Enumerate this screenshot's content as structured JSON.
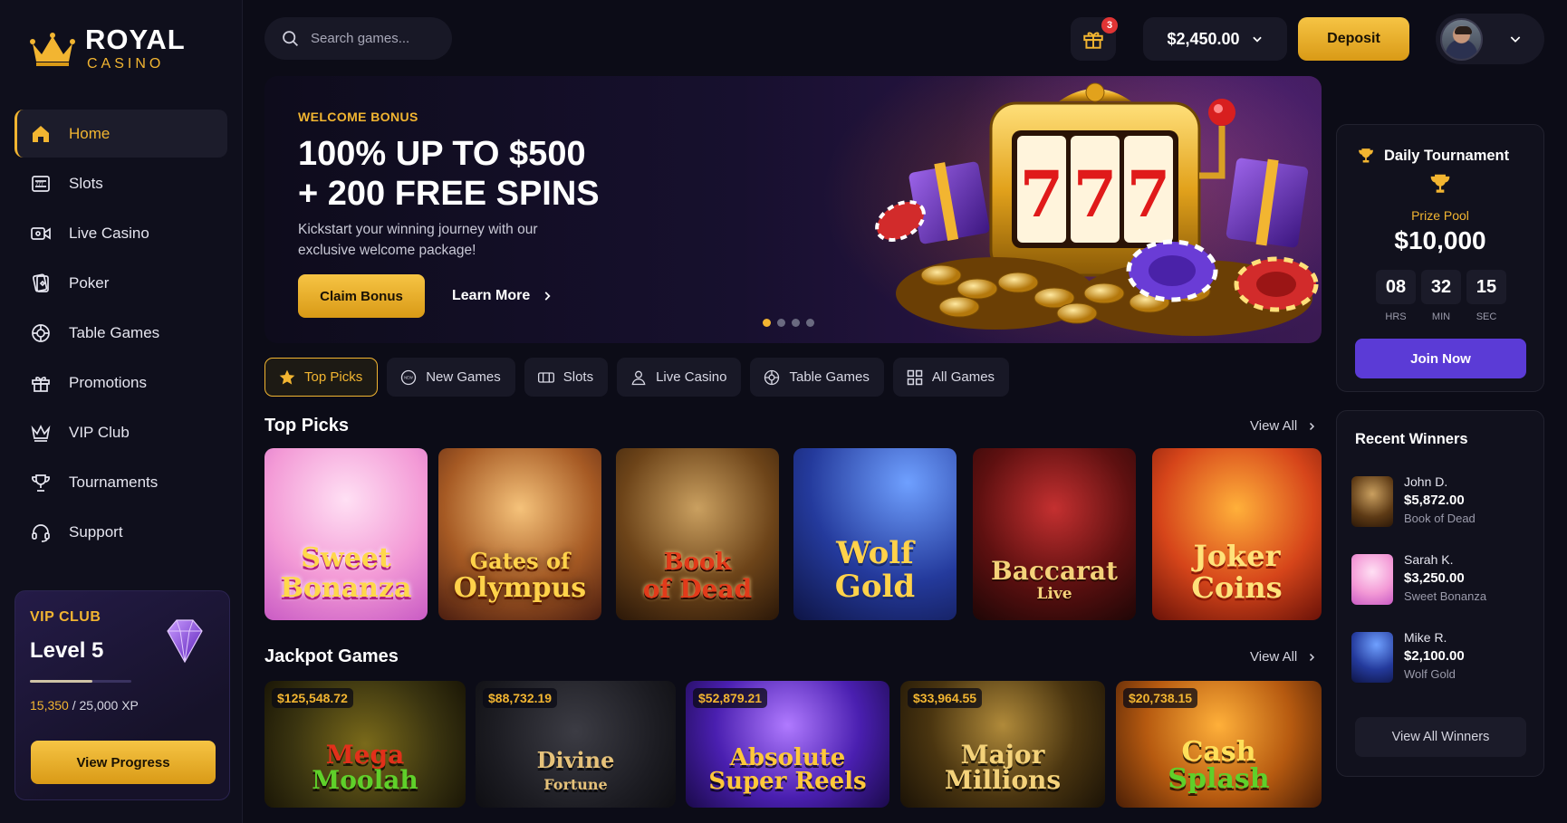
{
  "brand": {
    "name": "ROYAL",
    "sub": "CASINO"
  },
  "nav": [
    {
      "label": "Home",
      "icon": "home-icon",
      "active": true
    },
    {
      "label": "Slots",
      "icon": "slot-machine-icon"
    },
    {
      "label": "Live Casino",
      "icon": "video-camera-icon"
    },
    {
      "label": "Poker",
      "icon": "playing-cards-icon"
    },
    {
      "label": "Table Games",
      "icon": "roulette-icon"
    },
    {
      "label": "Promotions",
      "icon": "gift-icon"
    },
    {
      "label": "VIP Club",
      "icon": "crown-icon"
    },
    {
      "label": "Tournaments",
      "icon": "trophy-icon"
    },
    {
      "label": "Support",
      "icon": "headset-icon"
    }
  ],
  "vip": {
    "title": "VIP CLUB",
    "level": "Level 5",
    "xp_current": "15,350",
    "xp_total": "/ 25,000 XP",
    "progress": 0.614,
    "button": "View Progress"
  },
  "header": {
    "search_placeholder": "Search games...",
    "notifications": "3",
    "balance": "$2,450.00",
    "deposit": "Deposit"
  },
  "hero": {
    "tag": "WELCOME BONUS",
    "title_line1": "100% UP TO $500",
    "title_line2": "+ 200 FREE SPINS",
    "subtitle": "Kickstart your winning journey with our exclusive welcome package!",
    "claim": "Claim Bonus",
    "learn_more": "Learn More",
    "slides": 4,
    "active_slide": 1
  },
  "tabs": [
    {
      "label": "Top Picks",
      "icon": "star-icon",
      "active": true
    },
    {
      "label": "New Games",
      "icon": "new-chip-icon"
    },
    {
      "label": "Slots",
      "icon": "slot-machine-icon"
    },
    {
      "label": "Live Casino",
      "icon": "person-icon"
    },
    {
      "label": "Table Games",
      "icon": "roulette-icon"
    },
    {
      "label": "All Games",
      "icon": "grid-icon"
    }
  ],
  "top_picks": {
    "title": "Top Picks",
    "view_all": "View All",
    "games": [
      {
        "name": "Sweet",
        "sub": "Bonanza",
        "badge": ""
      },
      {
        "name": "Gates of",
        "sub": "Olympus",
        "badge": ""
      },
      {
        "name": "Book",
        "sub": "of Dead",
        "badge": ""
      },
      {
        "name": "Wolf",
        "sub": "Gold",
        "badge": ""
      },
      {
        "name": "Baccarat",
        "sub": "Live",
        "badge": ""
      },
      {
        "name": "Joker",
        "sub": "Coins",
        "badge": ""
      }
    ]
  },
  "jackpot": {
    "title": "Jackpot Games",
    "view_all": "View All",
    "games": [
      {
        "amount": "$125,548.72",
        "name": "Mega",
        "sub": "Moolah"
      },
      {
        "amount": "$88,732.19",
        "name": "Divine",
        "sub": "Fortune"
      },
      {
        "amount": "$52,879.21",
        "name": "Absolute",
        "sub": "Super Reels"
      },
      {
        "amount": "$33,964.55",
        "name": "Major",
        "sub": "Millions"
      },
      {
        "amount": "$20,738.15",
        "name": "Cash",
        "sub": "Splash"
      }
    ]
  },
  "tournament": {
    "title": "Daily Tournament",
    "prize_label": "Prize Pool",
    "prize": "$10,000",
    "hrs": "08",
    "min": "32",
    "sec": "15",
    "hrs_label": "HRS",
    "min_label": "MIN",
    "sec_label": "SEC",
    "join": "Join Now"
  },
  "winners": {
    "title": "Recent Winners",
    "list": [
      {
        "name": "John D.",
        "amount": "$5,872.00",
        "game": "Book of Dead"
      },
      {
        "name": "Sarah K.",
        "amount": "$3,250.00",
        "game": "Sweet Bonanza"
      },
      {
        "name": "Mike R.",
        "amount": "$2,100.00",
        "game": "Wolf Gold"
      }
    ],
    "view_all": "View All Winners"
  },
  "colors": {
    "accent": "#f2b531",
    "purple": "#5b3bd6",
    "bg": "#0c0c17"
  }
}
